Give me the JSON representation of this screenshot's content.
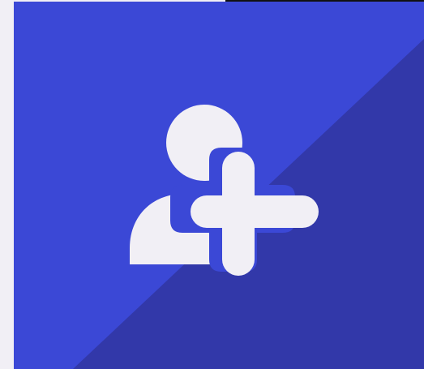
{
  "tile": {
    "icon": "add-user-icon",
    "colors": {
      "page_background": "#f1eff5",
      "tile_light": "#3b48d6",
      "tile_shadow": "#3238a9",
      "icon_fill": "#f1eff5",
      "top_edge": "#111111"
    }
  }
}
